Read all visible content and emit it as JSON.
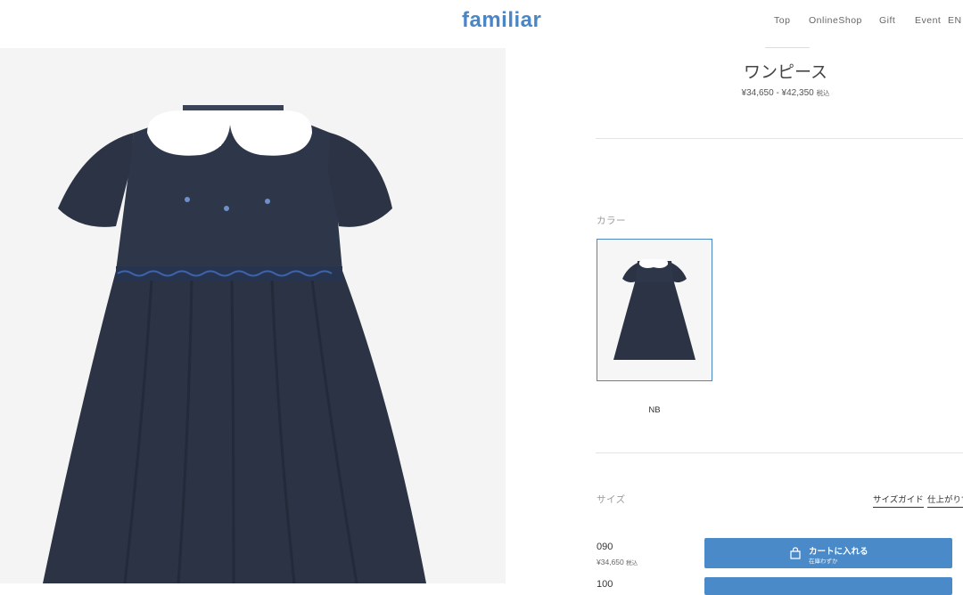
{
  "header": {
    "logo": "familiar",
    "nav": [
      "Top",
      "OnlineShop",
      "Gift",
      "Event",
      "EN"
    ]
  },
  "product": {
    "title": "ワンピース",
    "price": "¥34,650 - ¥42,350",
    "tax_label": "税込"
  },
  "color_section": {
    "label": "カラー",
    "selected": "NB"
  },
  "size_section": {
    "label": "サイズ",
    "guide_link": "サイズガイド",
    "finish_link": "仕上がり寸",
    "rows": [
      {
        "code": "090",
        "price": "¥34,650",
        "tax_label": "税込",
        "button_label": "カートに入れる",
        "button_sub": "在庫わずか"
      },
      {
        "code": "100"
      }
    ]
  },
  "colors": {
    "brand": "#4a86c5",
    "button": "#4a8ac9",
    "dress": "#2b3345"
  }
}
